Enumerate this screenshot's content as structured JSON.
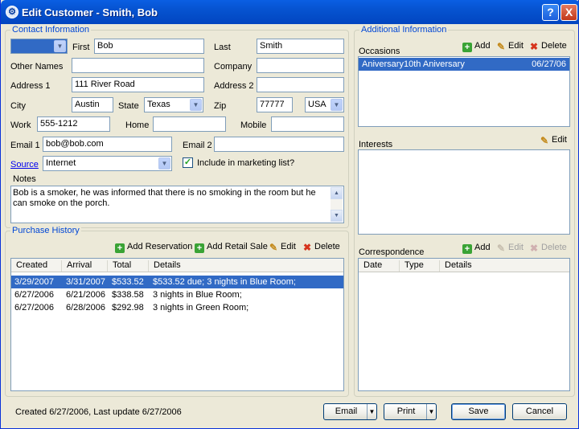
{
  "window": {
    "title": "Edit Customer - Smith, Bob",
    "help": "?",
    "close": "X"
  },
  "contact": {
    "group_title": "Contact Information",
    "first_label": "First",
    "first_value": "Bob",
    "last_label": "Last",
    "last_value": "Smith",
    "other_names_label": "Other Names",
    "other_names_value": "",
    "company_label": "Company",
    "company_value": "",
    "address1_label": "Address 1",
    "address1_value": "111 River Road",
    "address2_label": "Address 2",
    "address2_value": "",
    "city_label": "City",
    "city_value": "Austin",
    "state_label": "State",
    "state_value": "Texas",
    "zip_label": "Zip",
    "zip_value": "77777",
    "country_value": "USA",
    "work_label": "Work",
    "work_value": "555-1212",
    "home_label": "Home",
    "home_value": "",
    "mobile_label": "Mobile",
    "mobile_value": "",
    "email1_label": "Email 1",
    "email1_value": "bob@bob.com",
    "email2_label": "Email 2",
    "email2_value": "",
    "source_label": "Source",
    "source_value": "Internet",
    "marketing_label": "Include in marketing list?",
    "marketing_checked": true,
    "notes_label": "Notes",
    "notes_value": "Bob is a smoker, he was informed that there is no smoking in the room but he can smoke on the porch."
  },
  "purchase": {
    "group_title": "Purchase History",
    "add_reservation": "Add Reservation",
    "add_retail": "Add Retail Sale",
    "edit": "Edit",
    "delete": "Delete",
    "columns": [
      "Created",
      "Arrival",
      "Total",
      "Details"
    ],
    "rows": [
      [
        "3/29/2007",
        "3/31/2007",
        "$533.52",
        "$533.52 due; 3 nights in Blue Room;"
      ],
      [
        "6/27/2006",
        "6/21/2006",
        "$338.58",
        "3 nights in Blue Room;"
      ],
      [
        "6/27/2006",
        "6/28/2006",
        "$292.98",
        "3 nights in Green Room;"
      ]
    ]
  },
  "additional": {
    "group_title": "Additional Information",
    "add": "Add",
    "edit": "Edit",
    "delete": "Delete",
    "occasions_label": "Occasions",
    "occasions": [
      {
        "name": "Aniversary",
        "desc": "10th Aniversary",
        "date": "06/27/06"
      }
    ],
    "interests_label": "Interests",
    "interests_edit": "Edit",
    "correspondence_label": "Correspondence",
    "corr_add": "Add",
    "corr_edit": "Edit",
    "corr_delete": "Delete",
    "corr_columns": [
      "Date",
      "Type",
      "Details"
    ]
  },
  "footer": {
    "status": "Created 6/27/2006, Last update 6/27/2006",
    "email": "Email",
    "print": "Print",
    "save": "Save",
    "cancel": "Cancel"
  },
  "colors": {
    "selection": "#316ac5",
    "title_blue": "#0046d5",
    "titlebar": "#0653d0"
  }
}
